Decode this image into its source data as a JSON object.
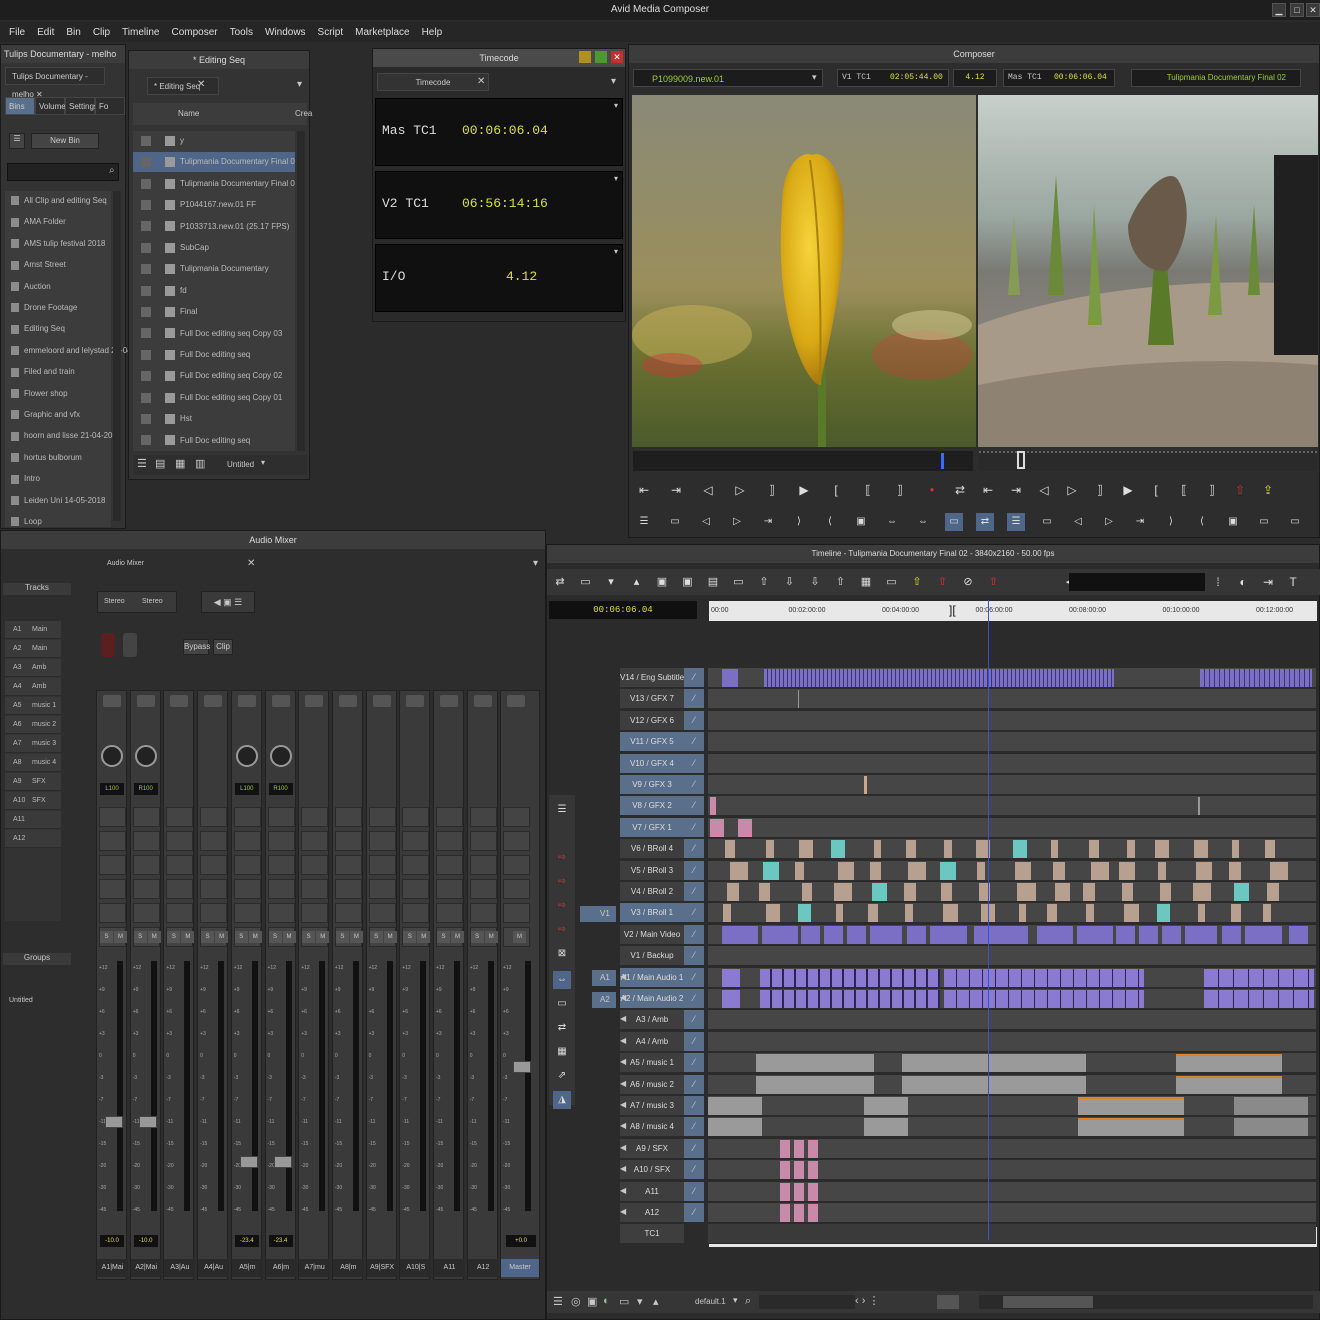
{
  "app": {
    "title": "Avid Media Composer",
    "menus": [
      "File",
      "Edit",
      "Bin",
      "Clip",
      "Timeline",
      "Composer",
      "Tools",
      "Windows",
      "Script",
      "Marketplace",
      "Help"
    ]
  },
  "project": {
    "title": "Tulips Documentary - melho",
    "tab": "Tulips Documentary - melho",
    "tabs": [
      "Bins",
      "Volumes",
      "Settings",
      "Fo"
    ],
    "new_bin": "New Bin",
    "bins": [
      "All Clip and editing Seq",
      "AMA Folder",
      "AMS tulip festival 2018",
      "Amst Street",
      "Auction",
      "Drone Footage",
      "Editing Seq",
      "emmeloord and lelystad 23-04-20",
      "Filed and train",
      "Flower shop",
      "Graphic and vfx",
      "hoorn and lisse 21-04-2018",
      "hortus bulborum",
      "Intro",
      "Leiden Uni 14-05-2018",
      "Loop"
    ]
  },
  "bin": {
    "title": "* Editing Seq",
    "tab": "* Editing Seq",
    "col_name": "Name",
    "col_created": "Crea",
    "items": [
      "y",
      "Tulipmania Documentary Final 02",
      "Tulipmania Documentary Final 01",
      "P1044167.new.01 FF",
      "P1033713.new.01 (25.17 FPS)",
      "SubCap",
      "Tulipmania Documentary",
      "fd",
      "Final",
      "Full Doc editing seq Copy 03",
      "Full Doc editing seq",
      "Full Doc editing seq Copy 02",
      "Full Doc editing seq Copy 01",
      "Hst",
      "Full Doc editing seq"
    ],
    "footer": "Untitled"
  },
  "timecode": {
    "title": "Timecode",
    "tab": "Timecode",
    "rows": [
      {
        "label": "Mas TC1",
        "value": "00:06:06.04"
      },
      {
        "label": "V2 TC1",
        "value": "06:56:14:16"
      },
      {
        "label": "I/O",
        "value": "4.12"
      }
    ]
  },
  "composer": {
    "title": "Composer",
    "source_clip": "P1099009.new.01",
    "v1_label": "V1 TC1",
    "v1_value": "02:05:44.00",
    "dur_value": "4.12",
    "mas_label": "Mas TC1",
    "mas_value": "00:06:06.04",
    "record_seq": "Tulipmania Documentary Final 02"
  },
  "mixer": {
    "title": "Audio Mixer",
    "tab": "Audio Mixer",
    "tracks_header": "Tracks",
    "tracks": [
      {
        "id": "A1",
        "name": "Main Audio"
      },
      {
        "id": "A2",
        "name": "Main Audio"
      },
      {
        "id": "A3",
        "name": "Amb"
      },
      {
        "id": "A4",
        "name": "Amb"
      },
      {
        "id": "A5",
        "name": "music 1"
      },
      {
        "id": "A6",
        "name": "music 2"
      },
      {
        "id": "A7",
        "name": "music 3"
      },
      {
        "id": "A8",
        "name": "music 4"
      },
      {
        "id": "A9",
        "name": "SFX"
      },
      {
        "id": "A10",
        "name": "SFX"
      },
      {
        "id": "A11",
        "name": ""
      },
      {
        "id": "A12",
        "name": ""
      }
    ],
    "stereo1": "Stereo",
    "stereo2": "Stereo",
    "bypass": "Bypass",
    "clip": "Clip",
    "groups_header": "Groups",
    "groups_item": "Untitled",
    "scale": [
      "+12",
      "+9",
      "+6",
      "+3",
      "0",
      "-3",
      "-7",
      "-11",
      "-15",
      "-20",
      "-30",
      "-45"
    ],
    "channels": [
      {
        "name": "A1|Mai",
        "pan": "L100",
        "level": "-10.0",
        "fader": 0.62
      },
      {
        "name": "A2|Mai",
        "pan": "R100",
        "level": "-10.0",
        "fader": 0.62
      },
      {
        "name": "A3|Au",
        "pan": "",
        "level": "",
        "fader": null
      },
      {
        "name": "A4|Au",
        "pan": "",
        "level": "",
        "fader": null
      },
      {
        "name": "A5|m",
        "pan": "L100",
        "level": "-23.4",
        "fader": 0.78
      },
      {
        "name": "A6|m",
        "pan": "R100",
        "level": "-23.4",
        "fader": 0.78
      },
      {
        "name": "A7|mu",
        "pan": "",
        "level": "",
        "fader": null
      },
      {
        "name": "A8|m",
        "pan": "",
        "level": "",
        "fader": null
      },
      {
        "name": "A9|SFX",
        "pan": "",
        "level": "",
        "fader": null
      },
      {
        "name": "A10|S",
        "pan": "",
        "level": "",
        "fader": null
      },
      {
        "name": "A11",
        "pan": "",
        "level": "",
        "fader": null
      },
      {
        "name": "A12",
        "pan": "",
        "level": "",
        "fader": null
      },
      {
        "name": "Master",
        "pan": "",
        "level": "+0.0",
        "fader": 0.4
      }
    ]
  },
  "timeline": {
    "title": "Timeline - Tulipmania Documentary Final 02 - 3840x2160 - 50.00 fps",
    "timecode": "00:06:06.04",
    "ruler": [
      "00:00",
      "00:02:00:00",
      "00:04:00:00",
      "00:06:00:00",
      "00:08:00:00",
      "00:10:00:00",
      "00:12:00:00"
    ],
    "playhead": 0.46,
    "source_v1": "V1",
    "source_a1": "A1",
    "source_a2": "A2",
    "tracks": [
      "V14 / Eng Subtitle",
      "V13 / GFX 7",
      "V12 / GFX 6",
      "V11 / GFX 5",
      "V10 / GFX 4",
      "V9 / GFX 3",
      "V8 / GFX 2",
      "V7 / GFX 1",
      "V6 / BRoll 4",
      "V5 / BRoll 3",
      "V4 / BRoll 2",
      "V3 / BRoll 1",
      "V2 / Main Video",
      "V1 / Backup",
      "A1 / Main Audio 1",
      "A2 / Main Audio 2",
      "A3 / Amb",
      "A4 / Amb",
      "A5 / music 1",
      "A6 / music 2",
      "A7 / music 3",
      "A8 / music 4",
      "A9 / SFX",
      "A10 / SFX",
      "A11",
      "A12",
      "TC1"
    ],
    "footer_setting": "default.1"
  },
  "colors": {
    "timecode_text": "#d8e040",
    "video_clip": "#7a6fc4",
    "audio_clip": "#8a7ad0",
    "playhead": "#3a4fd8",
    "selected_track": "#5a6f8c"
  }
}
